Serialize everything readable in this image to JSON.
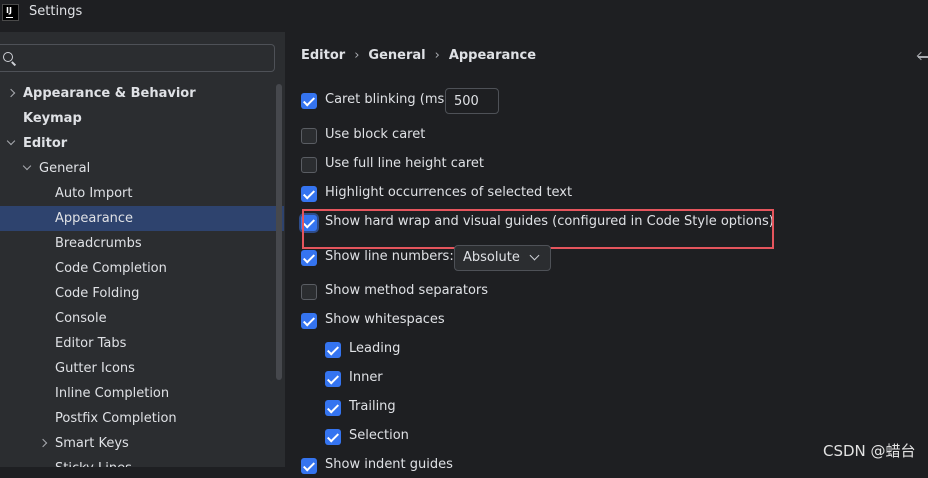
{
  "window": {
    "title": "Settings"
  },
  "search": {
    "value": "",
    "placeholder": ""
  },
  "sidebar": {
    "items": [
      {
        "label": "Appearance & Behavior"
      },
      {
        "label": "Keymap"
      },
      {
        "label": "Editor"
      },
      {
        "label": "General"
      },
      {
        "label": "Auto Import"
      },
      {
        "label": "Appearance"
      },
      {
        "label": "Breadcrumbs"
      },
      {
        "label": "Code Completion"
      },
      {
        "label": "Code Folding"
      },
      {
        "label": "Console"
      },
      {
        "label": "Editor Tabs"
      },
      {
        "label": "Gutter Icons"
      },
      {
        "label": "Inline Completion"
      },
      {
        "label": "Postfix Completion"
      },
      {
        "label": "Smart Keys"
      },
      {
        "label": "Sticky Lines"
      }
    ]
  },
  "breadcrumb": [
    "Editor",
    "General",
    "Appearance"
  ],
  "options": {
    "caret_blinking": {
      "label": "Caret blinking (ms):",
      "checked": true,
      "value": "500"
    },
    "block_caret": {
      "label": "Use block caret",
      "checked": false
    },
    "full_line_height_caret": {
      "label": "Use full line height caret",
      "checked": false
    },
    "highlight_occurrences": {
      "label": "Highlight occurrences of selected text",
      "checked": true
    },
    "hard_wrap_guides": {
      "label": "Show hard wrap and visual guides (configured in Code Style options)",
      "checked": true
    },
    "line_numbers": {
      "label": "Show line numbers:",
      "checked": true,
      "selected": "Absolute"
    },
    "method_separators": {
      "label": "Show method separators",
      "checked": false
    },
    "whitespaces": {
      "label": "Show whitespaces",
      "checked": true
    },
    "leading": {
      "label": "Leading",
      "checked": true
    },
    "inner": {
      "label": "Inner",
      "checked": true
    },
    "trailing": {
      "label": "Trailing",
      "checked": true
    },
    "selection": {
      "label": "Selection",
      "checked": true
    },
    "indent_guides": {
      "label": "Show indent guides",
      "checked": true
    }
  },
  "watermark": "CSDN @蜡台",
  "colors": {
    "accent": "#3574f0",
    "selection": "#2e436e",
    "highlight_box": "#e5555d"
  }
}
